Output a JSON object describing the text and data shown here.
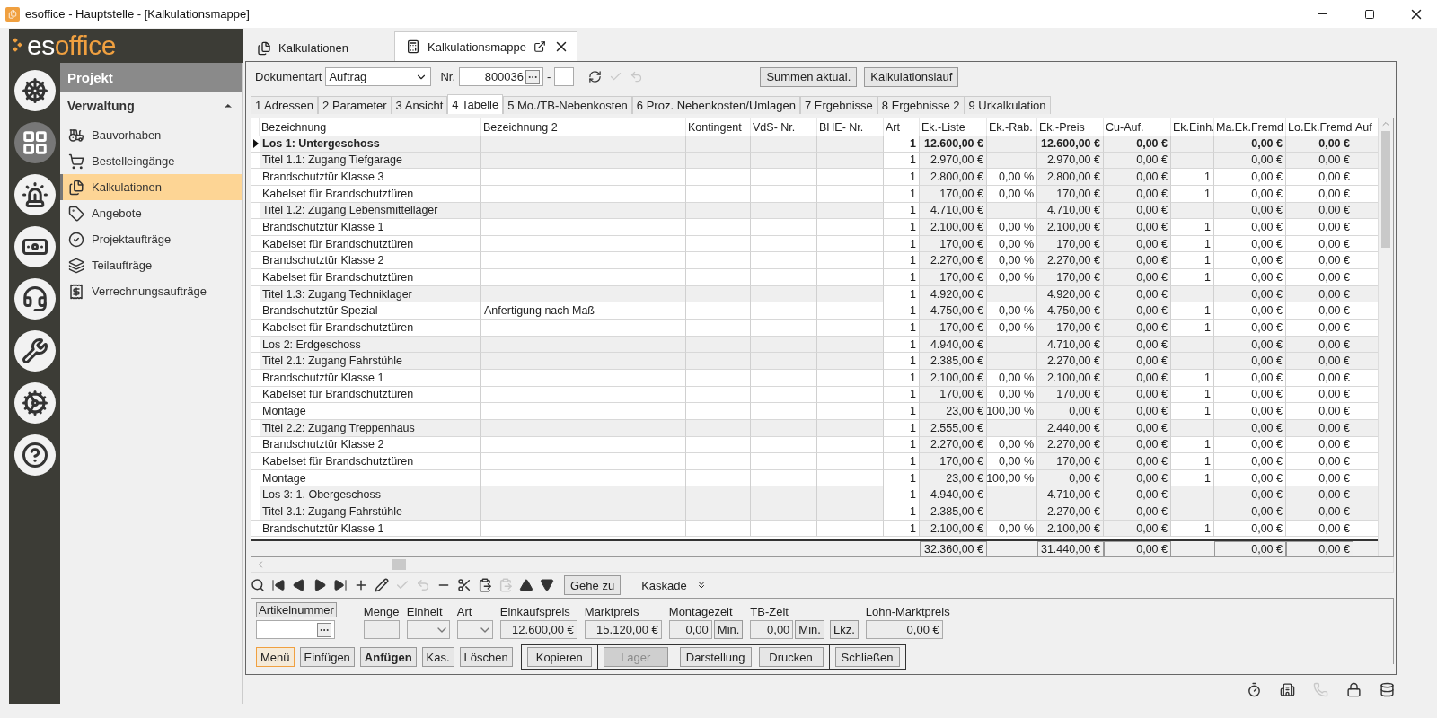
{
  "window": {
    "title": "esoffice - Hauptstelle - [Kalkulationsmappe]"
  },
  "logo": {
    "lead": "es",
    "rest": "office"
  },
  "rail": [
    {
      "selected": false
    },
    {
      "selected": true
    },
    {
      "selected": false
    },
    {
      "selected": false
    },
    {
      "selected": false
    },
    {
      "selected": false
    },
    {
      "selected": false
    },
    {
      "selected": false
    }
  ],
  "nav": {
    "header": "Projekt",
    "section": "Verwaltung",
    "expanded": true,
    "items": [
      {
        "label": "Bauvorhaben",
        "selected": false
      },
      {
        "label": "Bestelleingänge",
        "selected": false
      },
      {
        "label": "Kalkulationen",
        "selected": true
      },
      {
        "label": "Angebote",
        "selected": false
      },
      {
        "label": "Projektaufträge",
        "selected": false
      },
      {
        "label": "Teilaufträge",
        "selected": false
      },
      {
        "label": "Verrechnungsaufträge",
        "selected": false
      }
    ]
  },
  "tabs": [
    {
      "label": "Kalkulationen",
      "selected": false
    },
    {
      "label": "Kalkulationsmappe",
      "selected": true
    }
  ],
  "header_form": {
    "doc_type_label": "Dokumentart",
    "doc_type": "Auftrag",
    "nr_label": "Nr.",
    "nr": "800036",
    "separator": "-",
    "tools": [
      {
        "disabled": false
      },
      {
        "disabled": true
      },
      {
        "disabled": true
      }
    ],
    "buttons": [
      "Summen aktual.",
      "Kalkulationslauf"
    ]
  },
  "sub_tabs": [
    {
      "label": "1 Adressen",
      "selected": false
    },
    {
      "label": "2 Parameter",
      "selected": false
    },
    {
      "label": "3 Ansicht",
      "selected": false
    },
    {
      "label": "4 Tabelle",
      "selected": true
    },
    {
      "label": "5 Mo./TB-Nebenkosten",
      "selected": false
    },
    {
      "label": "6 Proz. Nebenkosten/Umlagen",
      "selected": false
    },
    {
      "label": "7 Ergebnisse",
      "selected": false
    },
    {
      "label": "8 Ergebnisse 2",
      "selected": false
    },
    {
      "label": "9 Urkalkulation",
      "selected": false
    }
  ],
  "table": {
    "columns": [
      "Bezeichnung",
      "Bezeichnung 2",
      "Kontingent",
      "VdS- Nr.",
      "BHE- Nr.",
      "Art",
      "Ek.-Liste",
      "Ek.-Rab.",
      "Ek.-Preis",
      "Cu-Auf.",
      "Ek.Einh.",
      "Ma.Ek.Fremd",
      "Lo.Ek.Fremd",
      "Auf"
    ],
    "rows": [
      {
        "kind": "group",
        "selected": true,
        "cells": [
          "Los 1: Untergeschoss",
          null,
          null,
          null,
          null,
          "1",
          "12.600,00 €",
          null,
          "12.600,00 €",
          "0,00 €",
          null,
          "0,00 €",
          "0,00 €"
        ]
      },
      {
        "kind": "group",
        "selected": false,
        "cells": [
          "Titel 1.1: Zugang Tiefgarage",
          null,
          null,
          null,
          null,
          "1",
          "2.970,00 €",
          null,
          "2.970,00 €",
          "0,00 €",
          null,
          "0,00 €",
          "0,00 €"
        ]
      },
      {
        "kind": "item",
        "selected": false,
        "cells": [
          "Brandschutztür Klasse 3",
          null,
          null,
          null,
          null,
          "1",
          "2.800,00 €",
          "0,00 %",
          "2.800,00 €",
          "0,00 €",
          "1",
          "0,00 €",
          "0,00 €"
        ]
      },
      {
        "kind": "item",
        "selected": false,
        "cells": [
          "Kabelset für Brandschutztüren",
          null,
          null,
          null,
          null,
          "1",
          "170,00 €",
          "0,00 %",
          "170,00 €",
          "0,00 €",
          "1",
          "0,00 €",
          "0,00 €"
        ]
      },
      {
        "kind": "group",
        "selected": false,
        "cells": [
          "Titel 1.2: Zugang Lebensmittellager",
          null,
          null,
          null,
          null,
          "1",
          "4.710,00 €",
          null,
          "4.710,00 €",
          "0,00 €",
          null,
          "0,00 €",
          "0,00 €"
        ]
      },
      {
        "kind": "item",
        "selected": false,
        "cells": [
          "Brandschutztür Klasse 1",
          null,
          null,
          null,
          null,
          "1",
          "2.100,00 €",
          "0,00 %",
          "2.100,00 €",
          "0,00 €",
          "1",
          "0,00 €",
          "0,00 €"
        ]
      },
      {
        "kind": "item",
        "selected": false,
        "cells": [
          "Kabelset für Brandschutztüren",
          null,
          null,
          null,
          null,
          "1",
          "170,00 €",
          "0,00 %",
          "170,00 €",
          "0,00 €",
          "1",
          "0,00 €",
          "0,00 €"
        ]
      },
      {
        "kind": "item",
        "selected": false,
        "cells": [
          "Brandschutztür Klasse 2",
          null,
          null,
          null,
          null,
          "1",
          "2.270,00 €",
          "0,00 %",
          "2.270,00 €",
          "0,00 €",
          "1",
          "0,00 €",
          "0,00 €"
        ]
      },
      {
        "kind": "item",
        "selected": false,
        "cells": [
          "Kabelset für Brandschutztüren",
          null,
          null,
          null,
          null,
          "1",
          "170,00 €",
          "0,00 %",
          "170,00 €",
          "0,00 €",
          "1",
          "0,00 €",
          "0,00 €"
        ]
      },
      {
        "kind": "group",
        "selected": false,
        "cells": [
          "Titel 1.3: Zugang Techniklager",
          null,
          null,
          null,
          null,
          "1",
          "4.920,00 €",
          null,
          "4.920,00 €",
          "0,00 €",
          null,
          "0,00 €",
          "0,00 €"
        ]
      },
      {
        "kind": "item",
        "selected": false,
        "cells": [
          "Brandschutztür Spezial",
          "Anfertigung nach Maß",
          null,
          null,
          null,
          "1",
          "4.750,00 €",
          "0,00 %",
          "4.750,00 €",
          "0,00 €",
          "1",
          "0,00 €",
          "0,00 €"
        ]
      },
      {
        "kind": "item",
        "selected": false,
        "cells": [
          "Kabelset für Brandschutztüren",
          null,
          null,
          null,
          null,
          "1",
          "170,00 €",
          "0,00 %",
          "170,00 €",
          "0,00 €",
          "1",
          "0,00 €",
          "0,00 €"
        ]
      },
      {
        "kind": "group",
        "selected": false,
        "cells": [
          "Los 2: Erdgeschoss",
          null,
          null,
          null,
          null,
          "1",
          "4.940,00 €",
          null,
          "4.710,00 €",
          "0,00 €",
          null,
          "0,00 €",
          "0,00 €"
        ]
      },
      {
        "kind": "group",
        "selected": false,
        "cells": [
          "Titel 2.1: Zugang Fahrstühle",
          null,
          null,
          null,
          null,
          "1",
          "2.385,00 €",
          null,
          "2.270,00 €",
          "0,00 €",
          null,
          "0,00 €",
          "0,00 €"
        ]
      },
      {
        "kind": "item",
        "selected": false,
        "cells": [
          "Brandschutztür Klasse 1",
          null,
          null,
          null,
          null,
          "1",
          "2.100,00 €",
          "0,00 %",
          "2.100,00 €",
          "0,00 €",
          "1",
          "0,00 €",
          "0,00 €"
        ]
      },
      {
        "kind": "item",
        "selected": false,
        "cells": [
          "Kabelset für Brandschutztüren",
          null,
          null,
          null,
          null,
          "1",
          "170,00 €",
          "0,00 %",
          "170,00 €",
          "0,00 €",
          "1",
          "0,00 €",
          "0,00 €"
        ]
      },
      {
        "kind": "item",
        "selected": false,
        "cells": [
          "Montage",
          null,
          null,
          null,
          null,
          "1",
          "23,00 €",
          "100,00 %",
          "0,00 €",
          "0,00 €",
          "1",
          "0,00 €",
          "0,00 €"
        ]
      },
      {
        "kind": "group",
        "selected": false,
        "cells": [
          "Titel 2.2: Zugang Treppenhaus",
          null,
          null,
          null,
          null,
          "1",
          "2.555,00 €",
          null,
          "2.440,00 €",
          "0,00 €",
          null,
          "0,00 €",
          "0,00 €"
        ]
      },
      {
        "kind": "item",
        "selected": false,
        "cells": [
          "Brandschutztür Klasse 2",
          null,
          null,
          null,
          null,
          "1",
          "2.270,00 €",
          "0,00 %",
          "2.270,00 €",
          "0,00 €",
          "1",
          "0,00 €",
          "0,00 €"
        ]
      },
      {
        "kind": "item",
        "selected": false,
        "cells": [
          "Kabelset für Brandschutztüren",
          null,
          null,
          null,
          null,
          "1",
          "170,00 €",
          "0,00 %",
          "170,00 €",
          "0,00 €",
          "1",
          "0,00 €",
          "0,00 €"
        ]
      },
      {
        "kind": "item",
        "selected": false,
        "cells": [
          "Montage",
          null,
          null,
          null,
          null,
          "1",
          "23,00 €",
          "100,00 %",
          "0,00 €",
          "0,00 €",
          "1",
          "0,00 €",
          "0,00 €"
        ]
      },
      {
        "kind": "group",
        "selected": false,
        "cells": [
          "Los 3: 1. Obergeschoss",
          null,
          null,
          null,
          null,
          "1",
          "4.940,00 €",
          null,
          "4.710,00 €",
          "0,00 €",
          null,
          "0,00 €",
          "0,00 €"
        ]
      },
      {
        "kind": "group",
        "selected": false,
        "cells": [
          "Titel 3.1: Zugang Fahrstühle",
          null,
          null,
          null,
          null,
          "1",
          "2.385,00 €",
          null,
          "2.270,00 €",
          "0,00 €",
          null,
          "0,00 €",
          "0,00 €"
        ]
      },
      {
        "kind": "item",
        "selected": false,
        "cells": [
          "Brandschutztür Klasse 1",
          null,
          null,
          null,
          null,
          "1",
          "2.100,00 €",
          "0,00 %",
          "2.100,00 €",
          "0,00 €",
          "1",
          "0,00 €",
          "0,00 €"
        ]
      }
    ],
    "totals": [
      "32.360,00 €",
      "31.440,00 €",
      "0,00 €",
      "0,00 €",
      "0,00 €"
    ]
  },
  "toolbar": {
    "tools": [
      {
        "disabled": false
      },
      {
        "disabled": false
      },
      {
        "disabled": false
      },
      {
        "disabled": false
      },
      {
        "disabled": false
      },
      {
        "disabled": false
      },
      {
        "disabled": false
      },
      {
        "disabled": true
      },
      {
        "disabled": true
      },
      {
        "disabled": false
      },
      {
        "disabled": false
      },
      {
        "disabled": false
      },
      {
        "disabled": true
      },
      {
        "disabled": false
      },
      {
        "disabled": false
      }
    ],
    "goto": "Gehe zu",
    "cascade": "Kaskade"
  },
  "entry": {
    "article_label": "Artikelnummer",
    "fields": [
      {
        "label": "Menge",
        "kind": "text"
      },
      {
        "label": "Einheit",
        "kind": "select"
      },
      {
        "label": "Art",
        "kind": "select"
      },
      {
        "label": "Einkaufspreis",
        "kind": "text",
        "value": "12.600,00 €"
      },
      {
        "label": "Marktpreis",
        "kind": "text",
        "value": "15.120,00 €"
      },
      {
        "label": "Montagezeit",
        "kind": "text",
        "value": "0,00",
        "buttons": [
          "Min."
        ]
      },
      {
        "label": "TB-Zeit",
        "kind": "text",
        "value": "0,00",
        "buttons": [
          "Min.",
          "Lkz."
        ]
      },
      {
        "label": "Lohn-Marktpreis",
        "kind": "text",
        "value": "0,00 €"
      }
    ]
  },
  "actions_left": [
    {
      "label": "Menü",
      "kind": "focused"
    },
    {
      "label": "Einfügen",
      "kind": "normal"
    },
    {
      "label": "Anfügen",
      "kind": "default"
    },
    {
      "label": "Kas.",
      "kind": "normal"
    },
    {
      "label": "Löschen",
      "kind": "normal"
    }
  ],
  "actions_right": [
    {
      "label": "Kopieren",
      "disabled": false
    },
    {
      "label": "Lager",
      "disabled": true
    },
    {
      "label": "Darstellung",
      "disabled": false
    },
    {
      "label": "Drucken",
      "disabled": false
    },
    {
      "label": "Schließen",
      "disabled": false
    }
  ],
  "status_bar": {
    "icons": [
      {
        "disabled": false
      },
      {
        "disabled": false
      },
      {
        "disabled": true
      },
      {
        "disabled": false
      },
      {
        "disabled": false
      }
    ]
  }
}
